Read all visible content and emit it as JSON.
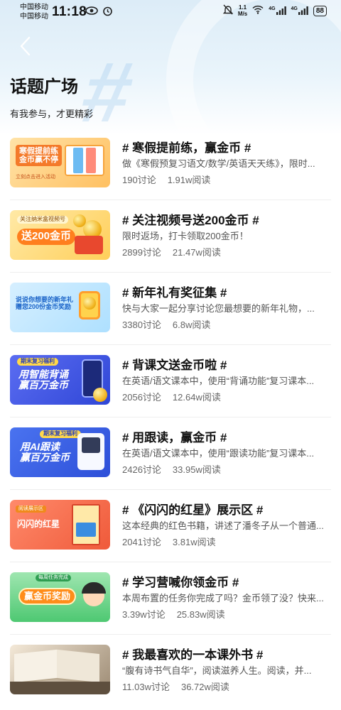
{
  "status_bar": {
    "carrier1": "中国移动",
    "carrier2": "中国移动",
    "time": "11:18",
    "net_speed_value": "1.1",
    "net_speed_unit": "M/s",
    "signal_label_1": "4G",
    "signal_label_2": "4G",
    "battery": "88"
  },
  "header": {
    "title": "话题广场",
    "subtitle": "有我参与，才更精彩"
  },
  "topics": [
    {
      "title": "# 寒假提前练，赢金币 #",
      "desc": "做《寒假预复习语文/数学/英语天天练》，限时...",
      "discussions": "190讨论",
      "reads": "1.91w阅读",
      "thumb_text": "寒假提前练\n金币赢不停",
      "thumb_sub": "立刻点击进入活动"
    },
    {
      "title": "# 关注视频号送200金币 #",
      "desc": "限时返场，打卡领取200金币！",
      "discussions": "2899讨论",
      "reads": "21.47w阅读",
      "thumb_text": "送200金币",
      "thumb_sub": "关注纳米盒视频号"
    },
    {
      "title": "# 新年礼有奖征集 #",
      "desc": "快与大家一起分享讨论您最想要的新年礼物，...",
      "discussions": "3380讨论",
      "reads": "6.8w阅读",
      "thumb_text": "说说你想要的新年礼\n赠您200份金币奖励",
      "thumb_sub": ""
    },
    {
      "title": "# 背课文送金币啦 #",
      "desc": "在英语/语文课本中，使用“背诵功能”复习课本...",
      "discussions": "2056讨论",
      "reads": "12.64w阅读",
      "thumb_text": "用智能背诵\n赢百万金币",
      "thumb_sub": "期末复习福利"
    },
    {
      "title": "# 用跟读，赢金币 #",
      "desc": "在英语/语文课本中，使用“跟读功能”复习课本...",
      "discussions": "2426讨论",
      "reads": "33.95w阅读",
      "thumb_text": "用AI跟读\n赢百万金币",
      "thumb_sub": "期末复习福利"
    },
    {
      "title": "# 《闪闪的红星》展示区 #",
      "desc": "这本经典的红色书籍，讲述了潘冬子从一个普通...",
      "discussions": "2041讨论",
      "reads": "3.81w阅读",
      "thumb_text": "闪闪的红星",
      "thumb_sub": "阅读展示区"
    },
    {
      "title": "# 学习营喊你领金币 #",
      "desc": "本周布置的任务你完成了吗？金币领了没？快来...",
      "discussions": "3.39w讨论",
      "reads": "25.83w阅读",
      "thumb_text": "赢金币奖励",
      "thumb_sub": "每周任务完成"
    },
    {
      "title": "# 我最喜欢的一本课外书 #",
      "desc": "“腹有诗书气自华”，阅读滋养人生。阅读，并...",
      "discussions": "11.03w讨论",
      "reads": "36.72w阅读",
      "thumb_text": "",
      "thumb_sub": ""
    }
  ]
}
